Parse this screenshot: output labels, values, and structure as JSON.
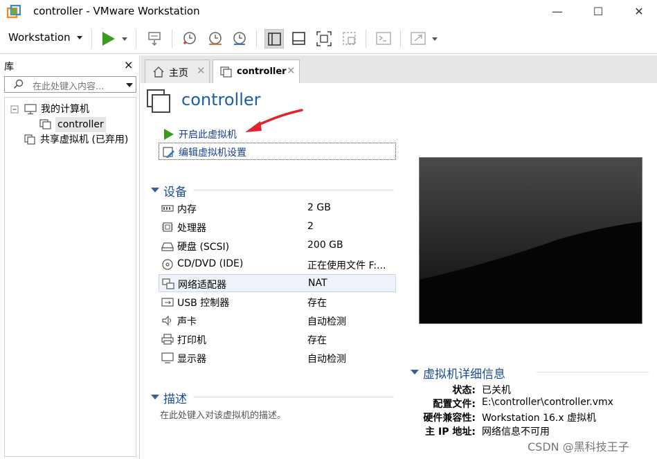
{
  "window": {
    "title": "controller - VMware Workstation",
    "minimize": "—",
    "maximize": "☐",
    "close": "✕"
  },
  "toolbar": {
    "menu_label": "Workstation"
  },
  "library": {
    "header": "库",
    "close": "×",
    "search_placeholder": "在此处键入内容...",
    "tree": {
      "my_computer": "我的计算机",
      "vm": "controller",
      "shared": "共享虚拟机 (已弃用)"
    }
  },
  "tabs": [
    {
      "label": "主页"
    },
    {
      "label": "controller"
    }
  ],
  "vm": {
    "name": "controller",
    "actions": {
      "power_on": "开启此虚拟机",
      "edit_settings": "编辑虚拟机设置"
    },
    "devices_header": "设备",
    "devices": [
      {
        "name": "内存",
        "value": "2 GB",
        "icon": "memory-icon"
      },
      {
        "name": "处理器",
        "value": "2",
        "icon": "cpu-icon"
      },
      {
        "name": "硬盘 (SCSI)",
        "value": "200 GB",
        "icon": "disk-icon"
      },
      {
        "name": "CD/DVD (IDE)",
        "value": "正在使用文件 F:...",
        "icon": "cd-icon"
      },
      {
        "name": "网络适配器",
        "value": "NAT",
        "icon": "network-icon"
      },
      {
        "name": "USB 控制器",
        "value": "存在",
        "icon": "usb-icon"
      },
      {
        "name": "声卡",
        "value": "自动检测",
        "icon": "sound-icon"
      },
      {
        "name": "打印机",
        "value": "存在",
        "icon": "printer-icon"
      },
      {
        "name": "显示器",
        "value": "自动检测",
        "icon": "monitor-icon"
      }
    ],
    "description_header": "描述",
    "description_placeholder": "在此处键入对该虚拟机的描述。",
    "details_header": "虚拟机详细信息",
    "details": [
      {
        "key": "状态:",
        "value": "已关机"
      },
      {
        "key": "配置文件:",
        "value": "E:\\controller\\controller.vmx"
      },
      {
        "key": "硬件兼容性:",
        "value": "Workstation 16.x 虚拟机"
      },
      {
        "key": "主 IP 地址:",
        "value": "网络信息不可用"
      }
    ]
  },
  "watermark": "CSDN @黑科技王子",
  "colors": {
    "accent": "#1a5fa8",
    "play_green": "#3a9a1e",
    "annotation_red": "#e0242b"
  }
}
